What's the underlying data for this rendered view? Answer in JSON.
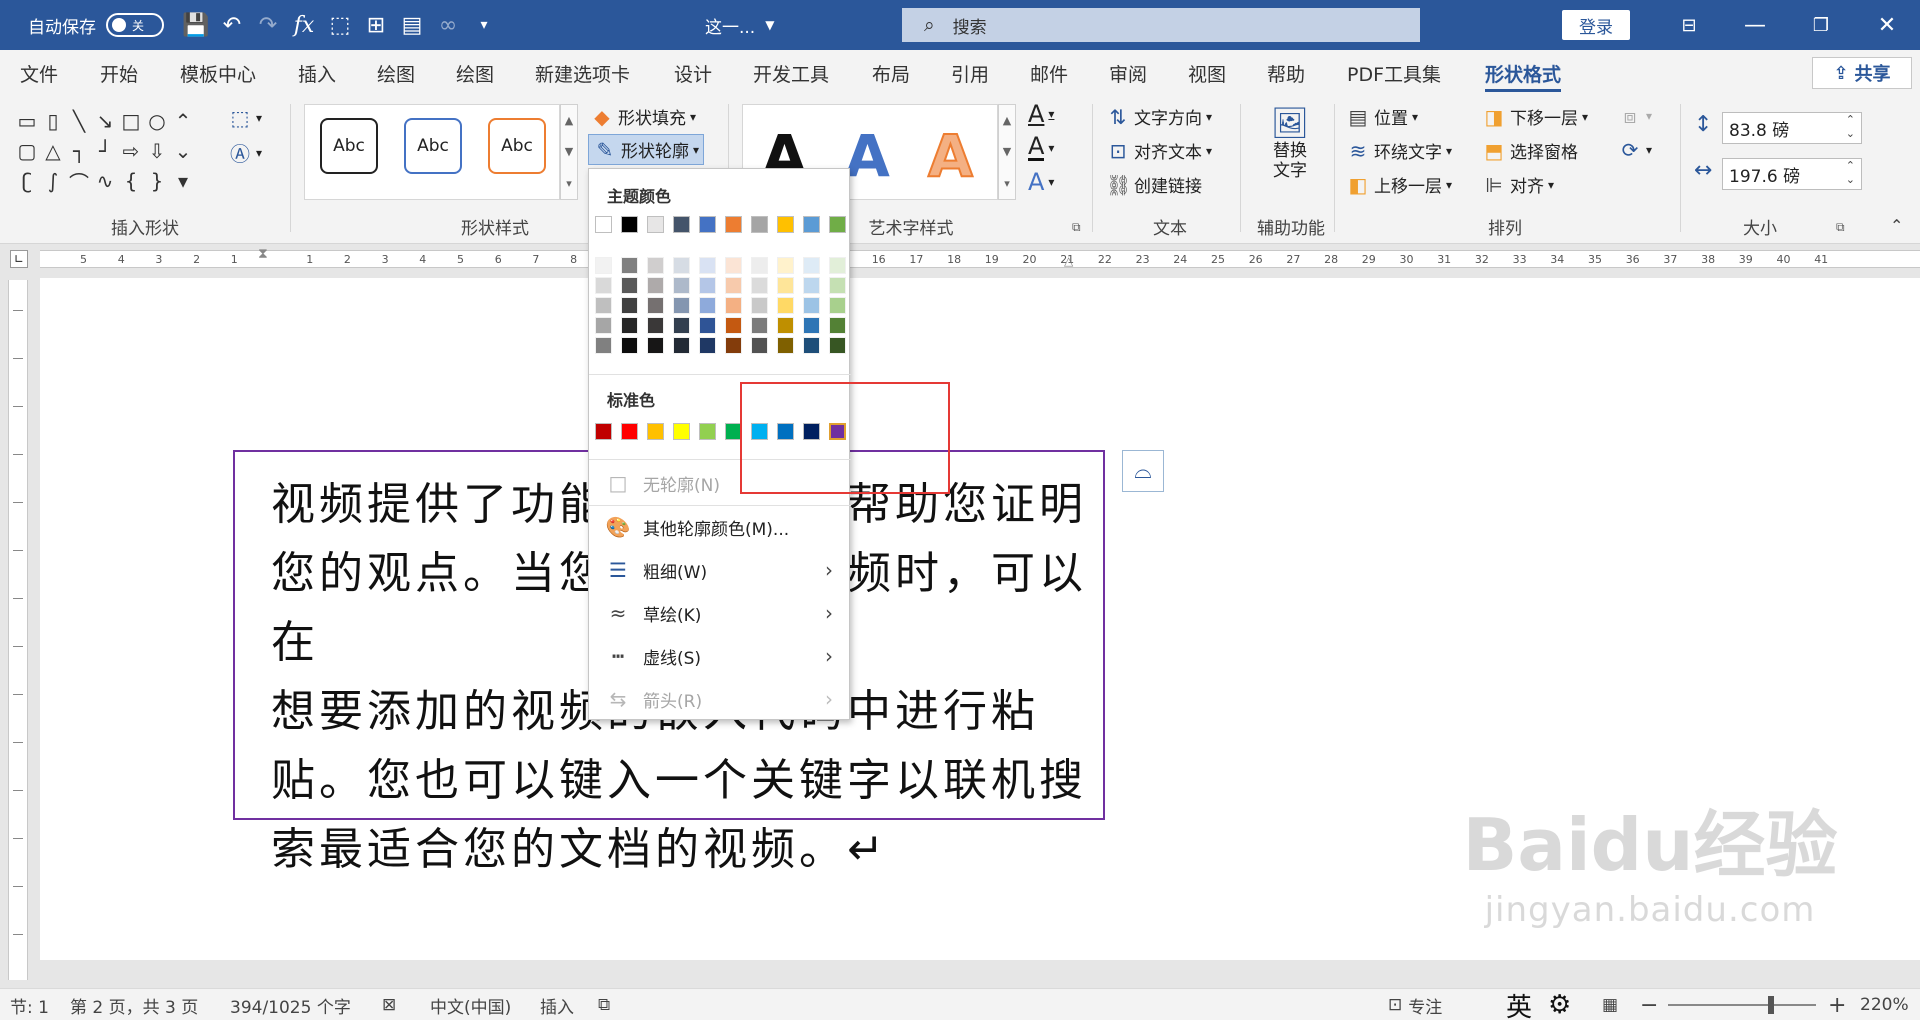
{
  "titlebar": {
    "autosave_label": "自动保存",
    "autosave_state": "关",
    "doc_title": "这一...",
    "search_placeholder": "搜索",
    "login_label": "登录"
  },
  "tabs": [
    "文件",
    "开始",
    "模板中心",
    "插入",
    "绘图",
    "绘图",
    "新建选项卡",
    "设计",
    "开发工具",
    "布局",
    "引用",
    "邮件",
    "审阅",
    "视图",
    "帮助",
    "PDF工具集",
    "形状格式"
  ],
  "active_tab": "形状格式",
  "share_label": "共享",
  "ribbon": {
    "groups": {
      "insert_shapes": "插入形状",
      "shape_styles": "形状样式",
      "wordart_styles": "艺术字样式",
      "text": "文本",
      "accessibility": "辅助功能",
      "arrange": "排列",
      "size": "大小"
    },
    "style_preview_label": "Abc",
    "shape_fill": "形状填充",
    "shape_outline": "形状轮廓",
    "wordart_letter": "A",
    "text_direction": "文字方向",
    "align_text": "对齐文本",
    "create_link": "创建链接",
    "alt_text": "替换文字",
    "position": "位置",
    "wrap_text": "环绕文字",
    "bring_forward": "上移一层",
    "send_backward": "下移一层",
    "selection_pane": "选择窗格",
    "align": "对齐",
    "height_value": "83.8 磅",
    "width_value": "197.6 磅"
  },
  "outline_dropdown": {
    "theme_colors_label": "主题颜色",
    "theme_top_row": [
      "#ffffff",
      "#000000",
      "#e7e6e6",
      "#44546a",
      "#4472c4",
      "#ed7d31",
      "#a5a5a5",
      "#ffc000",
      "#5b9bd5",
      "#70ad47"
    ],
    "theme_shades": [
      [
        "#f2f2f2",
        "#808080",
        "#d0cece",
        "#d6dce4",
        "#d9e2f3",
        "#fbe4d5",
        "#ededed",
        "#fff2cc",
        "#deebf6",
        "#e2efd9"
      ],
      [
        "#d9d9d9",
        "#595959",
        "#aeaaaa",
        "#adb9ca",
        "#b4c6e7",
        "#f7caac",
        "#dbdbdb",
        "#fee599",
        "#bdd7ee",
        "#c5e0b3"
      ],
      [
        "#bfbfbf",
        "#404040",
        "#757070",
        "#8496b0",
        "#8eaadb",
        "#f4b083",
        "#c9c9c9",
        "#ffd965",
        "#9cc3e5",
        "#a8d08d"
      ],
      [
        "#a6a6a6",
        "#262626",
        "#3a3838",
        "#323f4f",
        "#2f5496",
        "#c45911",
        "#7b7b7b",
        "#bf8f00",
        "#2e75b5",
        "#538135"
      ],
      [
        "#808080",
        "#0d0d0d",
        "#171616",
        "#222a35",
        "#1f3864",
        "#833c0b",
        "#525252",
        "#7f6000",
        "#1e4e79",
        "#375623"
      ]
    ],
    "standard_colors_label": "标准色",
    "standard_colors": [
      "#c00000",
      "#ff0000",
      "#ffc000",
      "#ffff00",
      "#92d050",
      "#00b050",
      "#00b0f0",
      "#0070c0",
      "#002060",
      "#7030a0"
    ],
    "no_outline": "无轮廓(N)",
    "more_colors": "其他轮廓颜色(M)...",
    "weight": "粗细(W)",
    "sketched": "草绘(K)",
    "dashes": "虚线(S)",
    "arrows": "箭头(R)"
  },
  "document": {
    "lines": [
      "视频提供了功能强大的方法帮助您证明",
      "您的观点。当您单击联机视频时，可以在",
      "想要添加的视频的嵌入代码中进行粘",
      "贴。您也可以键入一个关键字以联机搜",
      "索最适合您的文档的视频。↵"
    ]
  },
  "statusbar": {
    "section": "节: 1",
    "page": "第 2 页，共 3 页",
    "words": "394/1025 个字",
    "language": "中文(中国)",
    "mode": "插入",
    "focus": "专注",
    "ime": "英",
    "zoom": "220%"
  },
  "watermark": {
    "brand": "Baidu经验",
    "url": "jingyan.baidu.com"
  },
  "colors": {
    "titlebar_bg": "#2b579a",
    "textbox_border": "#7030a0",
    "highlight_box": "#e53935"
  }
}
